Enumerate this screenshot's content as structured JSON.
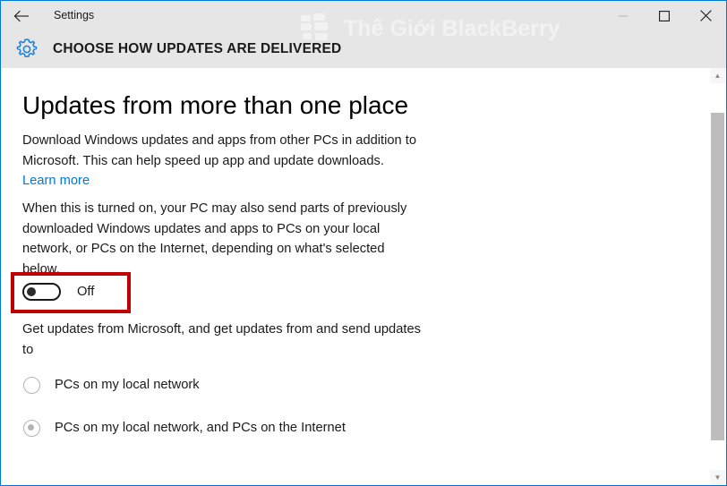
{
  "window": {
    "title": "Settings",
    "border_color": "#0078d7",
    "titlebar_bg": "#e6e6e6",
    "back_icon": "back-arrow-icon",
    "controls": [
      {
        "name": "minimize",
        "icon": "minimize-icon",
        "glyph": "─"
      },
      {
        "name": "maximize",
        "icon": "maximize-icon",
        "glyph": "□"
      },
      {
        "name": "close",
        "icon": "close-icon",
        "glyph": "✕"
      }
    ]
  },
  "header": {
    "icon": "gear-icon",
    "icon_color": "#0078d7",
    "title": "CHOOSE HOW UPDATES ARE DELIVERED"
  },
  "watermark": {
    "text": "Thế Giới BlackBerry",
    "logo": "blackberry-logo",
    "color": "#f2f2f2"
  },
  "main": {
    "heading": "Updates from more than one place",
    "paragraph_1": "Download Windows updates and apps from other PCs in addition to Microsoft. This can help speed up app and update downloads.",
    "learn_more": "Learn more",
    "learn_more_color": "#0078d7",
    "paragraph_2": "When this is turned on, your PC may also send parts of previously downloaded Windows updates and apps to PCs on your local network, or PCs on the Internet, depending on what's selected below.",
    "toggle": {
      "label": "Off",
      "state": "off",
      "highlight_color": "#c00000"
    },
    "radio_group_label": "Get updates from Microsoft, and get updates from and send updates to",
    "radios": [
      {
        "label": "PCs on my local network",
        "selected": false
      },
      {
        "label": "PCs on my local network, and PCs on the Internet",
        "selected": true
      }
    ]
  },
  "scrollbar": {
    "up_arrow": "chevron-up-icon",
    "down_arrow": "chevron-down-icon",
    "up_glyph": "▲",
    "down_glyph": "▼",
    "thumb_color": "#bdbdbd"
  }
}
